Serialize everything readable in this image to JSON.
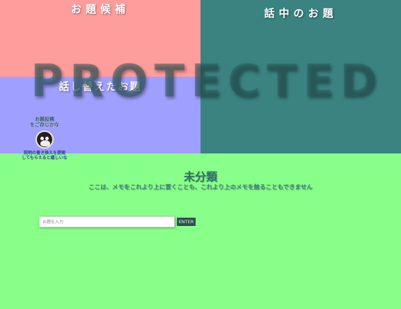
{
  "panels": {
    "candidates": {
      "title": "お題候補"
    },
    "talking": {
      "title": "話中のお題"
    },
    "changed": {
      "title": "話し替えたお題"
    },
    "unsorted": {
      "title": "未分類",
      "note": "ここは、メモをこれより上に置くことも、これより上のメモを触ることもできません"
    }
  },
  "mascot": {
    "caption_top": "お題投稿\nをご存じかな",
    "caption_bottom": "説明の書き換えを提案\nしてもらえると嬉しいな",
    "icon": "owl-icon"
  },
  "watermark": "PROTECTED",
  "input": {
    "placeholder": "お題を入力",
    "value": ""
  },
  "enter_label": "ENTER",
  "colors": {
    "candidates_bg": "#ff9d9d",
    "talking_bg": "#3a8380",
    "changed_bg": "#9f9fff",
    "unsorted_bg": "#88ff88"
  }
}
